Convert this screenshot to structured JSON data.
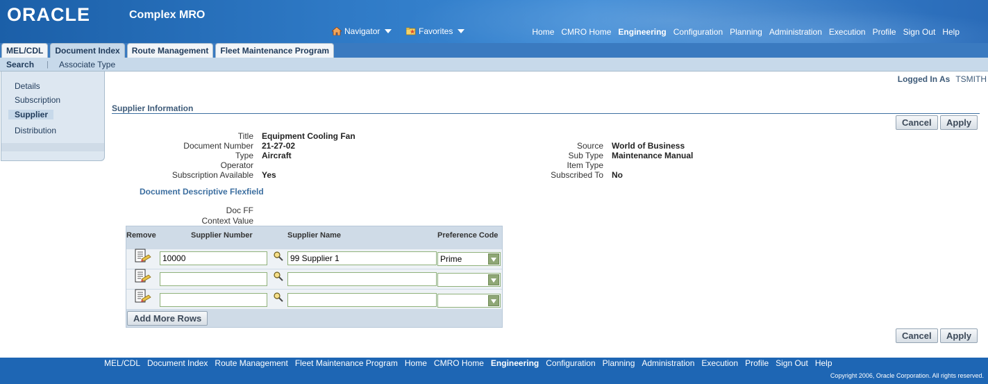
{
  "header": {
    "logo_text": "ORACLE",
    "app_title": "Complex MRO",
    "navigator_label": "Navigator",
    "favorites_label": "Favorites",
    "global_links": [
      "Home",
      "CMRO Home",
      "Engineering",
      "Configuration",
      "Planning",
      "Administration",
      "Execution",
      "Profile",
      "Sign Out",
      "Help"
    ],
    "selected_global_link": "Engineering"
  },
  "tabs": [
    {
      "label": "MEL/CDL",
      "active": false
    },
    {
      "label": "Document Index",
      "active": true
    },
    {
      "label": "Route Management",
      "active": false
    },
    {
      "label": "Fleet Maintenance Program",
      "active": false
    }
  ],
  "subtabs": {
    "search": "Search",
    "separator": "|",
    "associate_type": "Associate Type"
  },
  "sidenav": {
    "items": [
      "Details",
      "Subscription",
      "Supplier",
      "Distribution"
    ],
    "selected": "Supplier"
  },
  "logged_in": {
    "label": "Logged In As",
    "user": "TSMITH"
  },
  "section_title": "Supplier Information",
  "buttons": {
    "cancel": "Cancel",
    "apply": "Apply",
    "add_more_rows": "Add More Rows"
  },
  "fields_left": {
    "title_label": "Title",
    "title_value": "Equipment Cooling Fan",
    "docnum_label": "Document Number",
    "docnum_value": "21-27-02",
    "type_label": "Type",
    "type_value": "Aircraft",
    "operator_label": "Operator",
    "operator_value": "",
    "subavail_label": "Subscription Available",
    "subavail_value": "Yes"
  },
  "fields_right": {
    "source_label": "Source",
    "source_value": "World of Business",
    "subtype_label": "Sub Type",
    "subtype_value": "Maintenance Manual",
    "itemtype_label": "Item Type",
    "itemtype_value": "",
    "subscribed_label": "Subscribed To",
    "subscribed_value": "No"
  },
  "flexfield": {
    "title": "Document Descriptive Flexfield",
    "docff_label": "Doc FF",
    "context_label": "Context Value"
  },
  "table": {
    "columns": [
      "Remove",
      "Supplier Number",
      "Supplier Name",
      "Preference Code"
    ],
    "rows": [
      {
        "supplier_number": "10000",
        "supplier_name": "99 Supplier 1",
        "preference_code": "Prime"
      },
      {
        "supplier_number": "",
        "supplier_name": "",
        "preference_code": ""
      },
      {
        "supplier_number": "",
        "supplier_name": "",
        "preference_code": ""
      }
    ]
  },
  "footer": {
    "links": [
      "MEL/CDL",
      "Document Index",
      "Route Management",
      "Fleet Maintenance Program",
      "Home",
      "CMRO Home",
      "Engineering",
      "Configuration",
      "Planning",
      "Administration",
      "Execution",
      "Profile",
      "Sign Out",
      "Help"
    ],
    "selected": "Engineering",
    "copyright": "Copyright 2006, Oracle Corporation. All rights reserved."
  },
  "colors": {
    "header_blue": "#2f7ac6",
    "tab_active": "#c7d9ea",
    "section_blue": "#3d6fa0",
    "field_border": "#8fb17a"
  }
}
